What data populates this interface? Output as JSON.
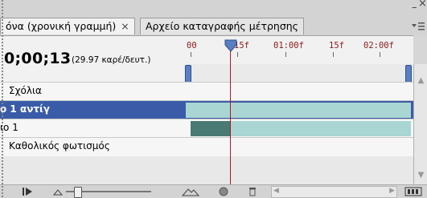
{
  "tabs": [
    {
      "label": "όνα (χρονική γραμμή)",
      "close": "×"
    },
    {
      "label": "Αρχείο καταγραφής μέτρησης"
    }
  ],
  "window_controls": {
    "minimize": "–",
    "close": "×"
  },
  "timeline": {
    "timecode": "0;00;13",
    "fps_label": "(29.97 καρέ/δευτ.)",
    "ruler_labels": [
      "00",
      "15f",
      "01:00f",
      "15f",
      "02:00f"
    ]
  },
  "layers": [
    {
      "label": "Σχόλια"
    },
    {
      "label": "ο 1 αντίγ"
    },
    {
      "label": "ιο 1"
    },
    {
      "label": "Καθολικός φωτισμός"
    }
  ],
  "colors": {
    "selected_row": "#3a5ca8",
    "clip_light": "#a9d6d2",
    "clip_dark": "#4a7a74",
    "playhead": "#b3122a",
    "ruler_text": "#8b1a1a"
  },
  "icons": {
    "play": "play-icon",
    "zoom_out": "mountain-small-icon",
    "zoom_in": "mountain-large-icon",
    "onion": "onion-skin-icon",
    "delete": "trash-icon",
    "convert": "filmstrip-icon"
  }
}
